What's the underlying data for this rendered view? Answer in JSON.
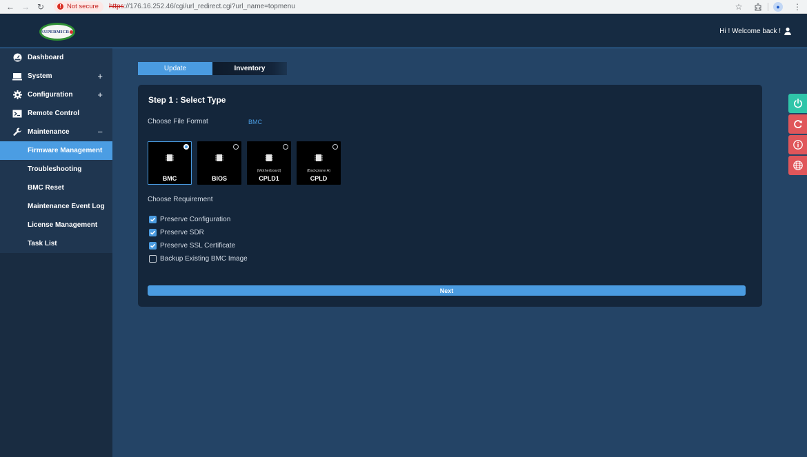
{
  "browser": {
    "security_label": "Not secure",
    "url_protocol": "https",
    "url_rest": "://176.16.252.46/cgi/url_redirect.cgi?url_name=topmenu"
  },
  "header": {
    "logo_text": "SUPERMICR",
    "welcome": "Hi ! Welcome back !"
  },
  "sidebar": {
    "items": [
      {
        "label": "Dashboard",
        "icon": "dashboard-icon",
        "toggle": ""
      },
      {
        "label": "System",
        "icon": "monitor-icon",
        "toggle": "+"
      },
      {
        "label": "Configuration",
        "icon": "gear-icon",
        "toggle": "+"
      },
      {
        "label": "Remote Control",
        "icon": "terminal-icon",
        "toggle": ""
      },
      {
        "label": "Maintenance",
        "icon": "wrench-icon",
        "toggle": "−"
      }
    ],
    "subitems": [
      {
        "label": "Firmware Management",
        "active": true
      },
      {
        "label": "Troubleshooting"
      },
      {
        "label": "BMC Reset"
      },
      {
        "label": "Maintenance Event Log"
      },
      {
        "label": "License Management"
      },
      {
        "label": "Task List"
      }
    ]
  },
  "tabs": {
    "update": "Update",
    "inventory": "Inventory"
  },
  "step": {
    "title": "Step 1 : Select Type",
    "file_format_label": "Choose File Format",
    "file_format_value": "BMC",
    "types": [
      {
        "label": "BMC",
        "sub": "",
        "selected": true
      },
      {
        "label": "BIOS",
        "sub": "",
        "selected": false
      },
      {
        "label": "CPLD1",
        "sub": "(Motherboard)",
        "selected": false
      },
      {
        "label": "CPLD",
        "sub": "(Backplane A)",
        "selected": false
      }
    ],
    "requirement_label": "Choose Requirement",
    "requirements": [
      {
        "label": "Preserve Configuration",
        "checked": true
      },
      {
        "label": "Preserve SDR",
        "checked": true
      },
      {
        "label": "Preserve SSL Certificate",
        "checked": true
      },
      {
        "label": "Backup Existing BMC Image",
        "checked": false
      }
    ],
    "next_label": "Next"
  },
  "colors": {
    "accent": "#4a9be0",
    "power": "#2fc5a9",
    "alert": "#e0565a"
  }
}
